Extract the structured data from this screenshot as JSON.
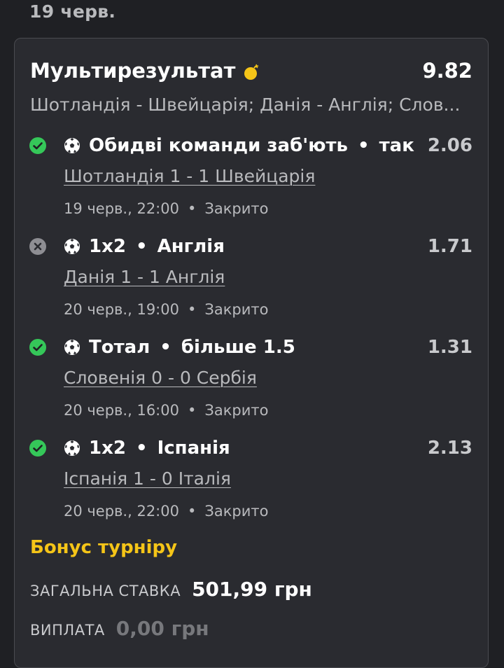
{
  "date_header": "19 черв.",
  "bet": {
    "title": "Мультирезультат",
    "total_odds": "9.82",
    "matches_summary": "Шотландія - Швейцарія; Данія - Англія; Слов...",
    "icons": {
      "title": "bomb-icon",
      "sport": "soccer-ball-icon"
    },
    "colors": {
      "won": "#35c759",
      "lost": "#8e8e93",
      "bonus": "#f5c518"
    }
  },
  "selections": [
    {
      "status": "won",
      "status_icon": "check-circle-icon",
      "market": "Обидві команди заб'ють",
      "pick": "так",
      "odds": "2.06",
      "match": "Шотландія 1 - 1 Швейцарія",
      "datetime": "19 черв., 22:00",
      "state": "Закрито"
    },
    {
      "status": "lost",
      "status_icon": "x-circle-icon",
      "market": "1x2",
      "pick": "Англія",
      "odds": "1.71",
      "match": "Данія 1 - 1 Англія",
      "datetime": "20 черв., 19:00",
      "state": "Закрито"
    },
    {
      "status": "won",
      "status_icon": "check-circle-icon",
      "market": "Тотал",
      "pick": "більше 1.5",
      "odds": "1.31",
      "match": "Словенія 0 - 0 Сербія",
      "datetime": "20 черв., 16:00",
      "state": "Закрито"
    },
    {
      "status": "won",
      "status_icon": "check-circle-icon",
      "market": "1x2",
      "pick": "Іспанія",
      "odds": "2.13",
      "match": "Іспанія 1 - 0 Італія",
      "datetime": "20 черв., 22:00",
      "state": "Закрито"
    }
  ],
  "bonus_label": "Бонус турніру",
  "stake": {
    "label": "ЗАГАЛЬНА СТАВКА",
    "value": "501,99 грн"
  },
  "payout": {
    "label": "ВИПЛАТА",
    "value": "0,00 грн"
  }
}
